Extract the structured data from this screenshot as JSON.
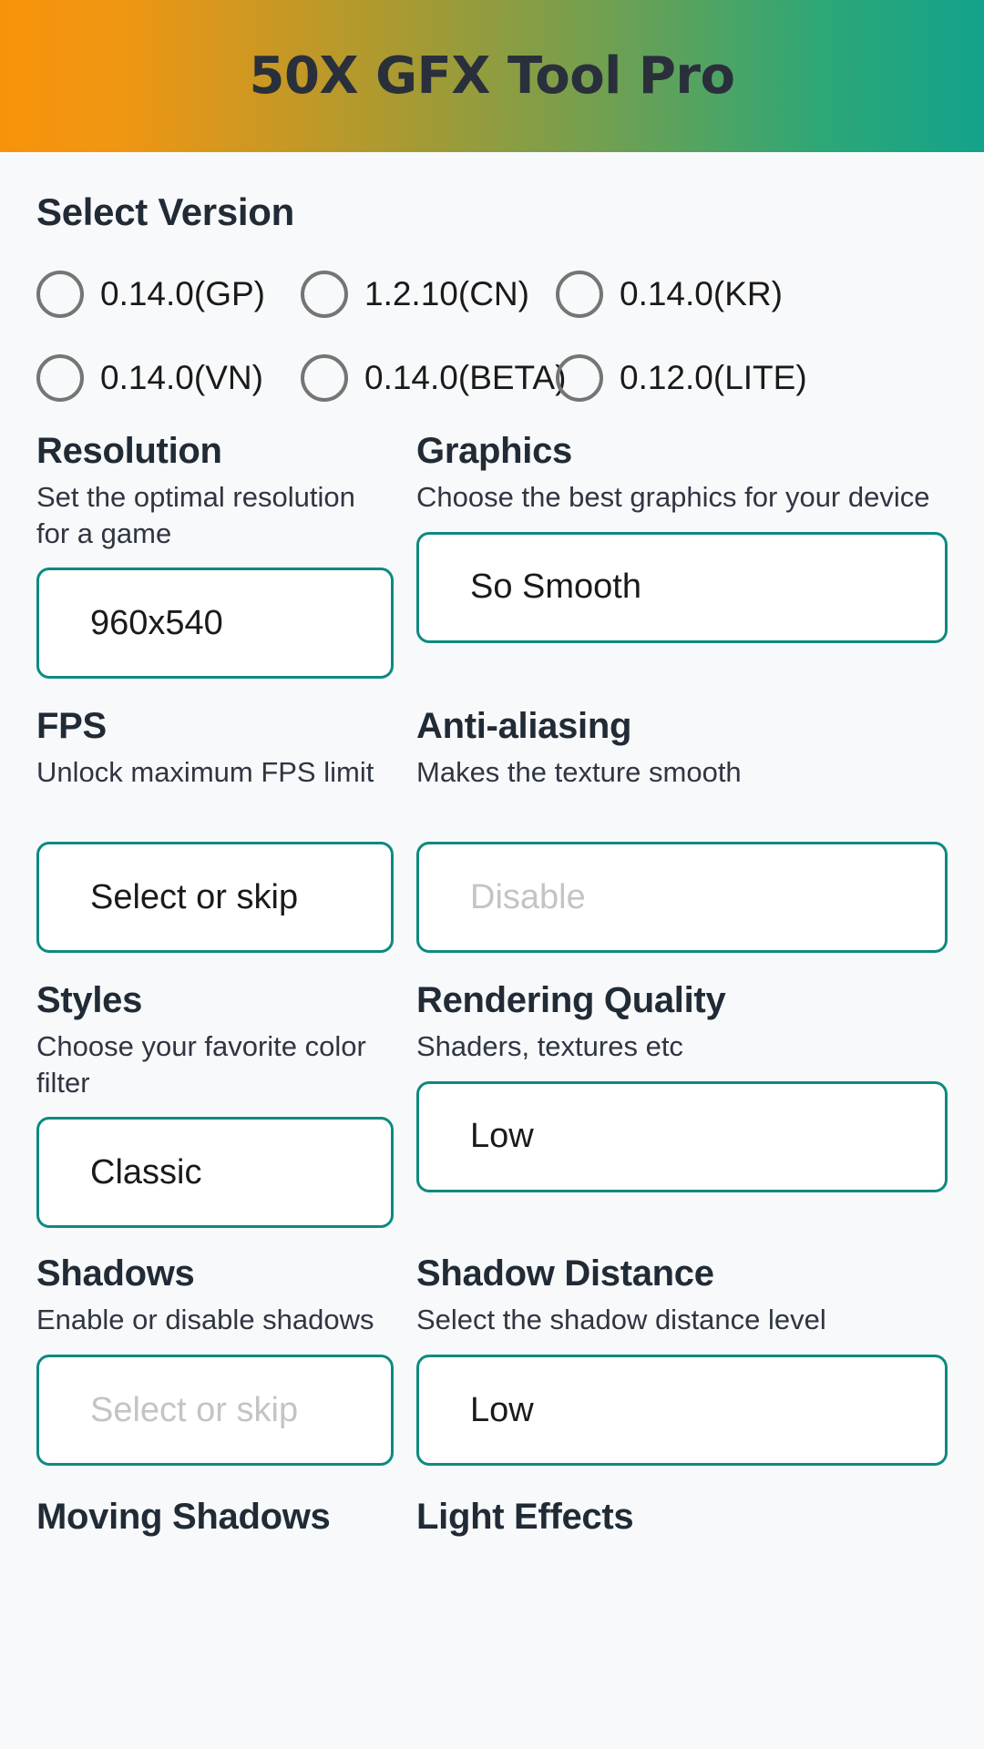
{
  "header": {
    "title": "50X GFX Tool Pro",
    "gradient_start": "#F7930A",
    "gradient_end": "#13A38B"
  },
  "theme": {
    "background": "#F8F9FA",
    "accent_border": "#0D8A80",
    "heading_color": "#212B36",
    "placeholder_color": "#C4C4C4",
    "radio_color": "#757575"
  },
  "version_section": {
    "heading": "Select Version",
    "options": [
      {
        "label": "0.14.0(GP)",
        "selected": false
      },
      {
        "label": "1.2.10(CN)",
        "selected": false
      },
      {
        "label": "0.14.0(KR)",
        "selected": false
      },
      {
        "label": "0.14.0(VN)",
        "selected": false
      },
      {
        "label": "0.14.0(BETA)",
        "selected": false
      },
      {
        "label": "0.12.0(LITE)",
        "selected": false
      }
    ]
  },
  "settings": {
    "resolution": {
      "title": "Resolution",
      "description": "Set the optimal resolution for a game",
      "value": "960x540",
      "is_placeholder": false
    },
    "graphics": {
      "title": "Graphics",
      "description": "Choose the best graphics for your device",
      "value": "So Smooth",
      "is_placeholder": false
    },
    "fps": {
      "title": "FPS",
      "description": "Unlock maximum FPS limit",
      "value": "Select or skip",
      "is_placeholder": false
    },
    "anti_aliasing": {
      "title": "Anti-aliasing",
      "description": "Makes the texture smooth",
      "value": "Disable",
      "is_placeholder": true
    },
    "styles": {
      "title": "Styles",
      "description": "Choose your favorite color filter",
      "value": "Classic",
      "is_placeholder": false
    },
    "rendering_quality": {
      "title": "Rendering Quality",
      "description": "Shaders, textures etc",
      "value": "Low",
      "is_placeholder": false
    },
    "shadows": {
      "title": "Shadows",
      "description": "Enable or disable shadows",
      "value": "Select or skip",
      "is_placeholder": true
    },
    "shadow_distance": {
      "title": "Shadow Distance",
      "description": "Select the shadow distance level",
      "value": "Low",
      "is_placeholder": false
    },
    "moving_shadows": {
      "title": "Moving Shadows"
    },
    "light_effects": {
      "title": "Light Effects"
    }
  }
}
